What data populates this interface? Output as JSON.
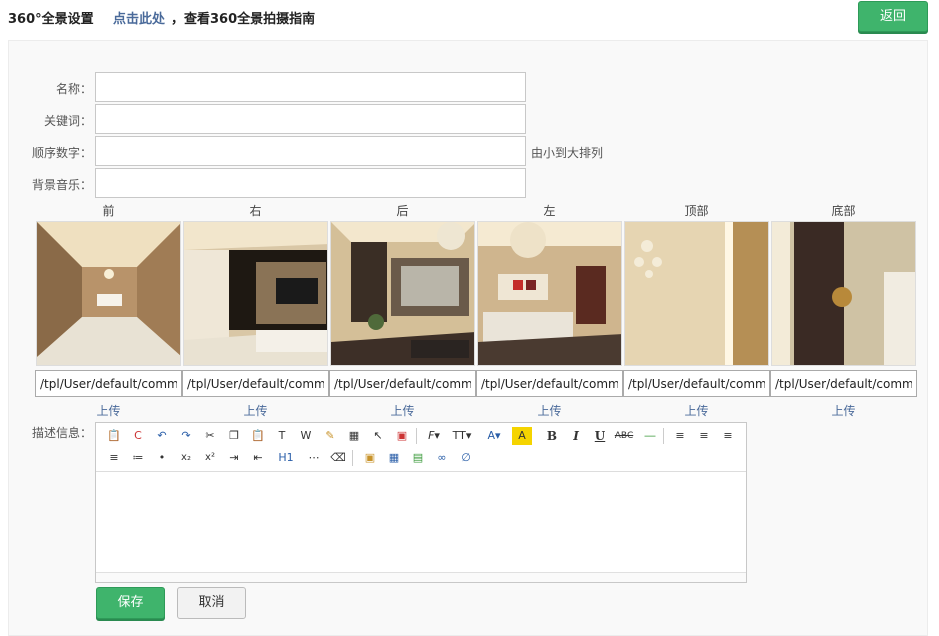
{
  "header": {
    "title": "360°全景设置",
    "guide_link": "点击此处",
    "guide_text": "，查看360全景拍摄指南",
    "back_label": "返回"
  },
  "form": {
    "name_label": "名称：",
    "name_value": "",
    "keyword_label": "关键词：",
    "keyword_value": "",
    "order_label": "顺序数字：",
    "order_value": "",
    "order_hint": "由小到大排列",
    "music_label": "背景音乐：",
    "music_value": "",
    "desc_label": "描述信息："
  },
  "panorama": {
    "faces": [
      {
        "label": "前",
        "path": "/tpl/User/default/common/images/panorama/front.jpg",
        "upload": "上传"
      },
      {
        "label": "右",
        "path": "/tpl/User/default/common/images/panorama/right.jpg",
        "upload": "上传"
      },
      {
        "label": "后",
        "path": "/tpl/User/default/common/images/panorama/back.jpg",
        "upload": "上传"
      },
      {
        "label": "左",
        "path": "/tpl/User/default/common/images/panorama/left.jpg",
        "upload": "上传"
      },
      {
        "label": "顶部",
        "path": "/tpl/User/default/common/images/panorama/top.jpg",
        "upload": "上传"
      },
      {
        "label": "底部",
        "path": "/tpl/User/default/common/images/panorama/bottom.jpg",
        "upload": "上传"
      }
    ]
  },
  "editor": {
    "heading_label": "H1",
    "content": ""
  },
  "actions": {
    "save_label": "保存",
    "cancel_label": "取消"
  },
  "colors": {
    "primary_green": "#3fb46c",
    "link_blue": "#4a6a9a"
  }
}
